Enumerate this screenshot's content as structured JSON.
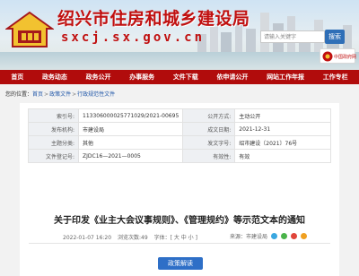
{
  "header": {
    "site_title": "绍兴市住房和城乡建设局",
    "site_url": "sxcj.sx.gov.cn",
    "search_placeholder": "请输入关键字",
    "search_button": "搜索",
    "badge_label": "中国政府网"
  },
  "nav": {
    "items": [
      "首页",
      "政务动态",
      "政务公开",
      "办事服务",
      "文件下载",
      "依申请公开",
      "网站工作年报",
      "工作专栏"
    ]
  },
  "breadcrumb": {
    "prefix": "您的位置：",
    "items": [
      "首页",
      "政策文件",
      "行政规范性文件"
    ]
  },
  "meta": {
    "rows": [
      {
        "k1": "索引号:",
        "v1": "11330600002577102​9/2021-00695",
        "k2": "公开方式:",
        "v2": "主动公开"
      },
      {
        "k1": "发布机构:",
        "v1": "市建设局",
        "k2": "成文日期:",
        "v2": "2021-12-31"
      },
      {
        "k1": "主题分类:",
        "v1": "其他",
        "k2": "发文字号:",
        "v2": "绍市建设〔2021〕76号"
      },
      {
        "k1": "文件登记号:",
        "v1": "ZJDC16—2021—0005",
        "k2": "有效性:",
        "v2": "有效"
      }
    ]
  },
  "document": {
    "title": "关于印发《业主大会议事规则》、《管理规约》等示范文本的通知",
    "date": "2022-01-07 16:20",
    "views": "浏览次数:49",
    "font_size_label": "字体：[ 大 中 小 ]",
    "source_label": "来源：市建设局",
    "interp_button": "政策解读"
  },
  "colors": {
    "brand_red": "#b10c0c",
    "title_red": "#c00f0f",
    "link_blue": "#1f56a8",
    "button_blue": "#2e6fc7"
  }
}
